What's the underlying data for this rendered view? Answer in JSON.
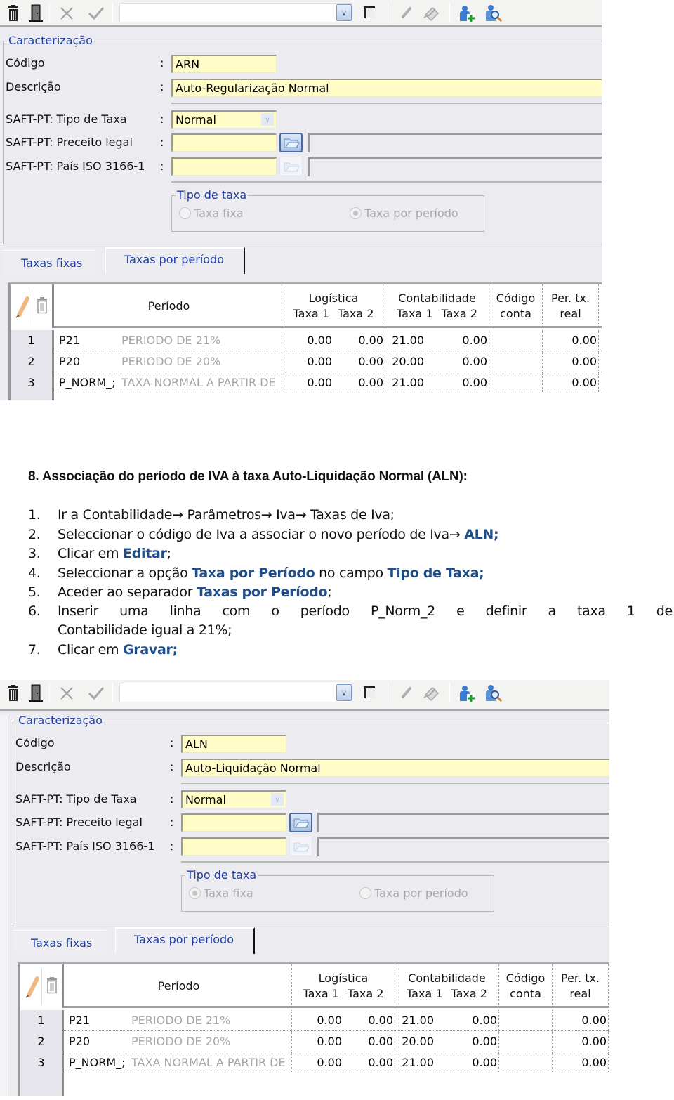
{
  "screens": [
    {
      "toolbar": {
        "icons": [
          "trash-icon",
          "exit-door-icon",
          "cancel-x-icon",
          "confirm-check-icon",
          "dropdown-arrow-icon",
          "checkbox-icon",
          "edit-pencil-icon",
          "edit-form-icon",
          "add-user-icon",
          "search-user-icon"
        ],
        "combo_value": ""
      },
      "section_title": "Caracterização",
      "fields": {
        "codigo_label": "Código",
        "codigo_value": "ARN",
        "descricao_label": "Descrição",
        "descricao_value": "Auto-Regularização Normal",
        "tipo_taxa_label": "SAFT-PT: Tipo de Taxa",
        "tipo_taxa_value": "Normal",
        "preceito_label": "SAFT-PT: Preceito legal",
        "preceito_value": "",
        "pais_label": "SAFT-PT: País ISO 3166-1",
        "pais_value": ""
      },
      "colon": ":",
      "tipo_de_taxa": {
        "title": "Tipo de taxa",
        "option_fixa": "Taxa fixa",
        "option_periodo": "Taxa por período",
        "selected": "Taxa por período"
      },
      "tabs": [
        {
          "label": "Taxas fixas",
          "active": false
        },
        {
          "label": "Taxas por período",
          "active": true
        }
      ],
      "grid": {
        "headers": {
          "periodo": "Período",
          "logistica": "Logística",
          "contabilidade": "Contabilidade",
          "taxa1": "Taxa 1",
          "taxa2": "Taxa 2",
          "codigo_line1": "Código",
          "codigo_line2": "conta",
          "per_line1": "Per. tx.",
          "per_line2": "real"
        },
        "rows": [
          {
            "n": "1",
            "code": "P21",
            "desc": "PERIODO DE 21%",
            "log_t1": "0.00",
            "log_t2": "0.00",
            "cont_t1": "21.00",
            "cont_t2": "0.00",
            "conta": "",
            "per": "0.00"
          },
          {
            "n": "2",
            "code": "P20",
            "desc": "PERIODO DE 20%",
            "log_t1": "0.00",
            "log_t2": "0.00",
            "cont_t1": "20.00",
            "cont_t2": "0.00",
            "conta": "",
            "per": "0.00"
          },
          {
            "n": "3",
            "code": "P_NORM_;",
            "desc": "TAXA NORMAL A PARTIR DE",
            "log_t1": "0.00",
            "log_t2": "0.00",
            "cont_t1": "21.00",
            "cont_t2": "0.00",
            "conta": "",
            "per": "0.00"
          }
        ]
      }
    },
    {
      "toolbar": {
        "icons": [
          "trash-icon",
          "exit-door-icon",
          "cancel-x-icon",
          "confirm-check-icon",
          "dropdown-arrow-icon",
          "checkbox-icon",
          "edit-pencil-icon",
          "edit-form-icon",
          "add-user-icon",
          "search-user-icon"
        ],
        "combo_value": ""
      },
      "section_title": "Caracterização",
      "fields": {
        "codigo_label": "Código",
        "codigo_value": "ALN",
        "descricao_label": "Descrição",
        "descricao_value": "Auto-Liquidação Normal",
        "tipo_taxa_label": "SAFT-PT: Tipo de Taxa",
        "tipo_taxa_value": "Normal",
        "preceito_label": "SAFT-PT: Preceito legal",
        "preceito_value": "",
        "pais_label": "SAFT-PT: País ISO 3166-1",
        "pais_value": ""
      },
      "colon": ":",
      "tipo_de_taxa": {
        "title": "Tipo de taxa",
        "option_fixa": "Taxa fixa",
        "option_periodo": "Taxa por período",
        "selected": "Taxa fixa"
      },
      "tabs": [
        {
          "label": "Taxas fixas",
          "active": false
        },
        {
          "label": "Taxas por período",
          "active": true
        }
      ],
      "grid": {
        "headers": {
          "periodo": "Período",
          "logistica": "Logística",
          "contabilidade": "Contabilidade",
          "taxa1": "Taxa 1",
          "taxa2": "Taxa 2",
          "codigo_line1": "Código",
          "codigo_line2": "conta",
          "per_line1": "Per. tx.",
          "per_line2": "real"
        },
        "rows": [
          {
            "n": "1",
            "code": "P21",
            "desc": "PERIODO DE 21%",
            "log_t1": "0.00",
            "log_t2": "0.00",
            "cont_t1": "21.00",
            "cont_t2": "0.00",
            "conta": "",
            "per": "0.00"
          },
          {
            "n": "2",
            "code": "P20",
            "desc": "PERIODO DE 20%",
            "log_t1": "0.00",
            "log_t2": "0.00",
            "cont_t1": "20.00",
            "cont_t2": "0.00",
            "conta": "",
            "per": "0.00"
          },
          {
            "n": "3",
            "code": "P_NORM_;",
            "desc": "TAXA NORMAL A PARTIR DE",
            "log_t1": "0.00",
            "log_t2": "0.00",
            "cont_t1": "21.00",
            "cont_t2": "0.00",
            "conta": "",
            "per": "0.00"
          }
        ]
      }
    }
  ],
  "document": {
    "heading": "8.   Associação do período de IVA à taxa Auto-Liquidação Normal (ALN):",
    "accent_color": "#1f4e8a",
    "steps": [
      {
        "n": "1.",
        "parts": [
          {
            "t": "Ir a Contabilidade→ Parâmetros→ Iva→ Taxas de Iva;",
            "b": false
          }
        ]
      },
      {
        "n": "2.",
        "parts": [
          {
            "t": "Seleccionar o código de Iva a associar o novo período de Iva→ ",
            "b": false
          },
          {
            "t": "ALN;",
            "b": true
          }
        ]
      },
      {
        "n": "3.",
        "parts": [
          {
            "t": "Clicar em ",
            "b": false
          },
          {
            "t": "Editar",
            "b": true
          },
          {
            "t": ";",
            "b": false
          }
        ]
      },
      {
        "n": "4.",
        "parts": [
          {
            "t": "Seleccionar a opção ",
            "b": false
          },
          {
            "t": "Taxa por Período",
            "b": true
          },
          {
            "t": " no campo ",
            "b": false
          },
          {
            "t": "Tipo de Taxa;",
            "b": true
          }
        ]
      },
      {
        "n": "5.",
        "parts": [
          {
            "t": "Aceder ao separador ",
            "b": false
          },
          {
            "t": "Taxas por Período",
            "b": true
          },
          {
            "t": ";",
            "b": false
          }
        ]
      },
      {
        "n": "6.",
        "justified_words": [
          "Inserir",
          "uma",
          "linha",
          "com",
          "o",
          "período",
          "P_Norm_2",
          "e",
          "definir",
          "a",
          "taxa",
          "1",
          "de"
        ],
        "continuation": "Contabilidade igual a 21%;"
      },
      {
        "n": "7.",
        "parts": [
          {
            "t": "Clicar em ",
            "b": false
          },
          {
            "t": "Gravar;",
            "b": true
          }
        ]
      }
    ]
  }
}
